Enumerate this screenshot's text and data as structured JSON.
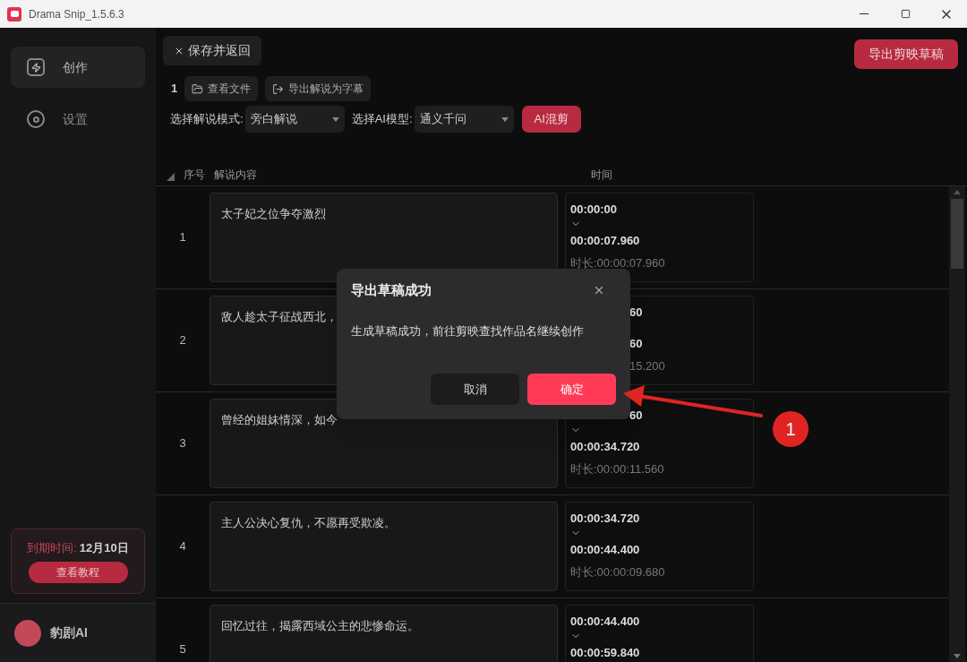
{
  "window": {
    "title": "Drama Snip_1.5.6.3"
  },
  "sidebar": {
    "items": [
      {
        "label": "创作",
        "selected": true,
        "kind": "bolt"
      },
      {
        "label": "设置",
        "selected": false,
        "kind": "target"
      }
    ],
    "expiry": {
      "label": "到期时间:",
      "value": "12月10日",
      "button": "查看教程"
    },
    "user": {
      "name": "豹剧AI"
    }
  },
  "toolbar": {
    "save_button": "保存并返回",
    "export_button": "导出剪映草稿",
    "count": "1",
    "view_files": "查看文件",
    "export_subtitles": "导出解说为字幕",
    "mode_label": "选择解说模式:",
    "mode_value": "旁白解说",
    "model_label": "选择AI模型:",
    "model_value": "通义千问",
    "ai_button": "AI混剪"
  },
  "table": {
    "columns": [
      "序号",
      "解说内容",
      "时间"
    ],
    "rows": [
      {
        "index": "1",
        "text": "太子妃之位争夺激烈",
        "start": "00:00:00",
        "end": "00:00:07.960",
        "duration": "时长:00:00:07.960",
        "kind": "plain"
      },
      {
        "index": "2",
        "text": "敌人趁太子征战西北，",
        "start": "60",
        "end": "60",
        "duration": "15.200",
        "kind": "covered"
      },
      {
        "index": "3",
        "text": "曾经的姐妹情深，如今",
        "start": "60",
        "end": "00:00:34.720",
        "duration": "时长:00:00:11.560",
        "kind": "start_covered"
      },
      {
        "index": "4",
        "text": "主人公决心复仇，不愿再受欺凌。",
        "start": "00:00:34.720",
        "end": "00:00:44.400",
        "duration": "时长:00:00:09.680",
        "kind": "plain"
      },
      {
        "index": "5",
        "text": "回忆过往，揭露西域公主的悲惨命运。",
        "start": "00:00:44.400",
        "end": "00:00:59.840",
        "kind": "plain"
      }
    ]
  },
  "dialog": {
    "title": "导出草稿成功",
    "message": "生成草稿成功，前往剪映查找作品名继续创作",
    "buttons": [
      {
        "label": "取消",
        "kind": "secondary"
      },
      {
        "label": "确定",
        "kind": "primary"
      }
    ]
  },
  "annotation": {
    "number": "1"
  }
}
